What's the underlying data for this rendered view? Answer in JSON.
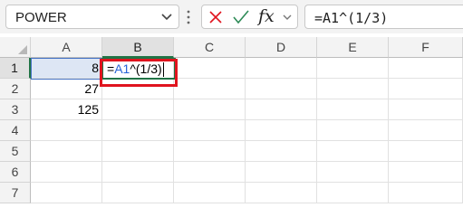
{
  "formula_bar": {
    "name_box_value": "POWER",
    "insert_function_label": "fx",
    "formula_text": "=A1^(1/3)"
  },
  "columns": [
    "A",
    "B",
    "C",
    "D",
    "E",
    "F"
  ],
  "selected_column": "B",
  "rows": [
    "1",
    "2",
    "3",
    "4",
    "5",
    "6",
    "7"
  ],
  "selected_row": "1",
  "cells": {
    "A1": "8",
    "A2": "27",
    "A3": "125"
  },
  "editing_cell": {
    "address": "B1",
    "prefix": "=",
    "reference": "A1",
    "suffix": "^(1/3)"
  },
  "colors": {
    "cancel": "#e0141e",
    "enter": "#2e8b57",
    "selection": "#217346",
    "reference": "#2764d8",
    "highlight": "#e0141e"
  }
}
